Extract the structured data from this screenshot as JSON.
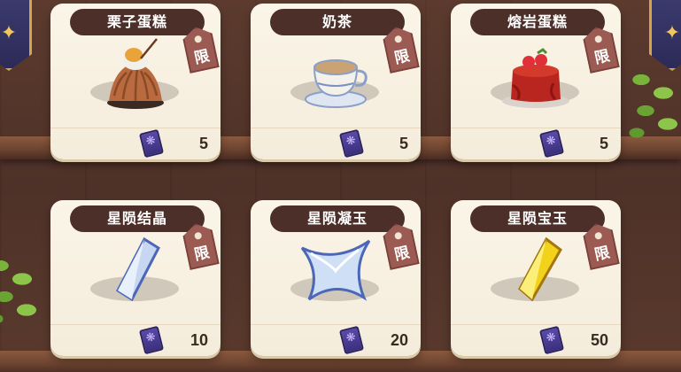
{
  "limited_tag_label": "限",
  "items": [
    {
      "name": "栗子蛋糕",
      "icon": "chestnut-cake-icon",
      "price": "5",
      "currency_icon": "star-ticket-icon"
    },
    {
      "name": "奶茶",
      "icon": "milk-tea-icon",
      "price": "5",
      "currency_icon": "star-ticket-icon"
    },
    {
      "name": "熔岩蛋糕",
      "icon": "lava-cake-icon",
      "price": "5",
      "currency_icon": "star-ticket-icon"
    },
    {
      "name": "星陨结晶",
      "icon": "blue-crystal-icon",
      "price": "10",
      "currency_icon": "star-ticket-icon"
    },
    {
      "name": "星陨凝玉",
      "icon": "star-jade-icon",
      "price": "20",
      "currency_icon": "star-ticket-icon"
    },
    {
      "name": "星陨宝玉",
      "icon": "yellow-gem-icon",
      "price": "50",
      "currency_icon": "star-ticket-icon"
    }
  ],
  "colors": {
    "title_bar": "#4d2f2a",
    "limited_tag": "#9b5a52",
    "card_bg": "#fbf5e8",
    "currency": "#4a3c96"
  }
}
